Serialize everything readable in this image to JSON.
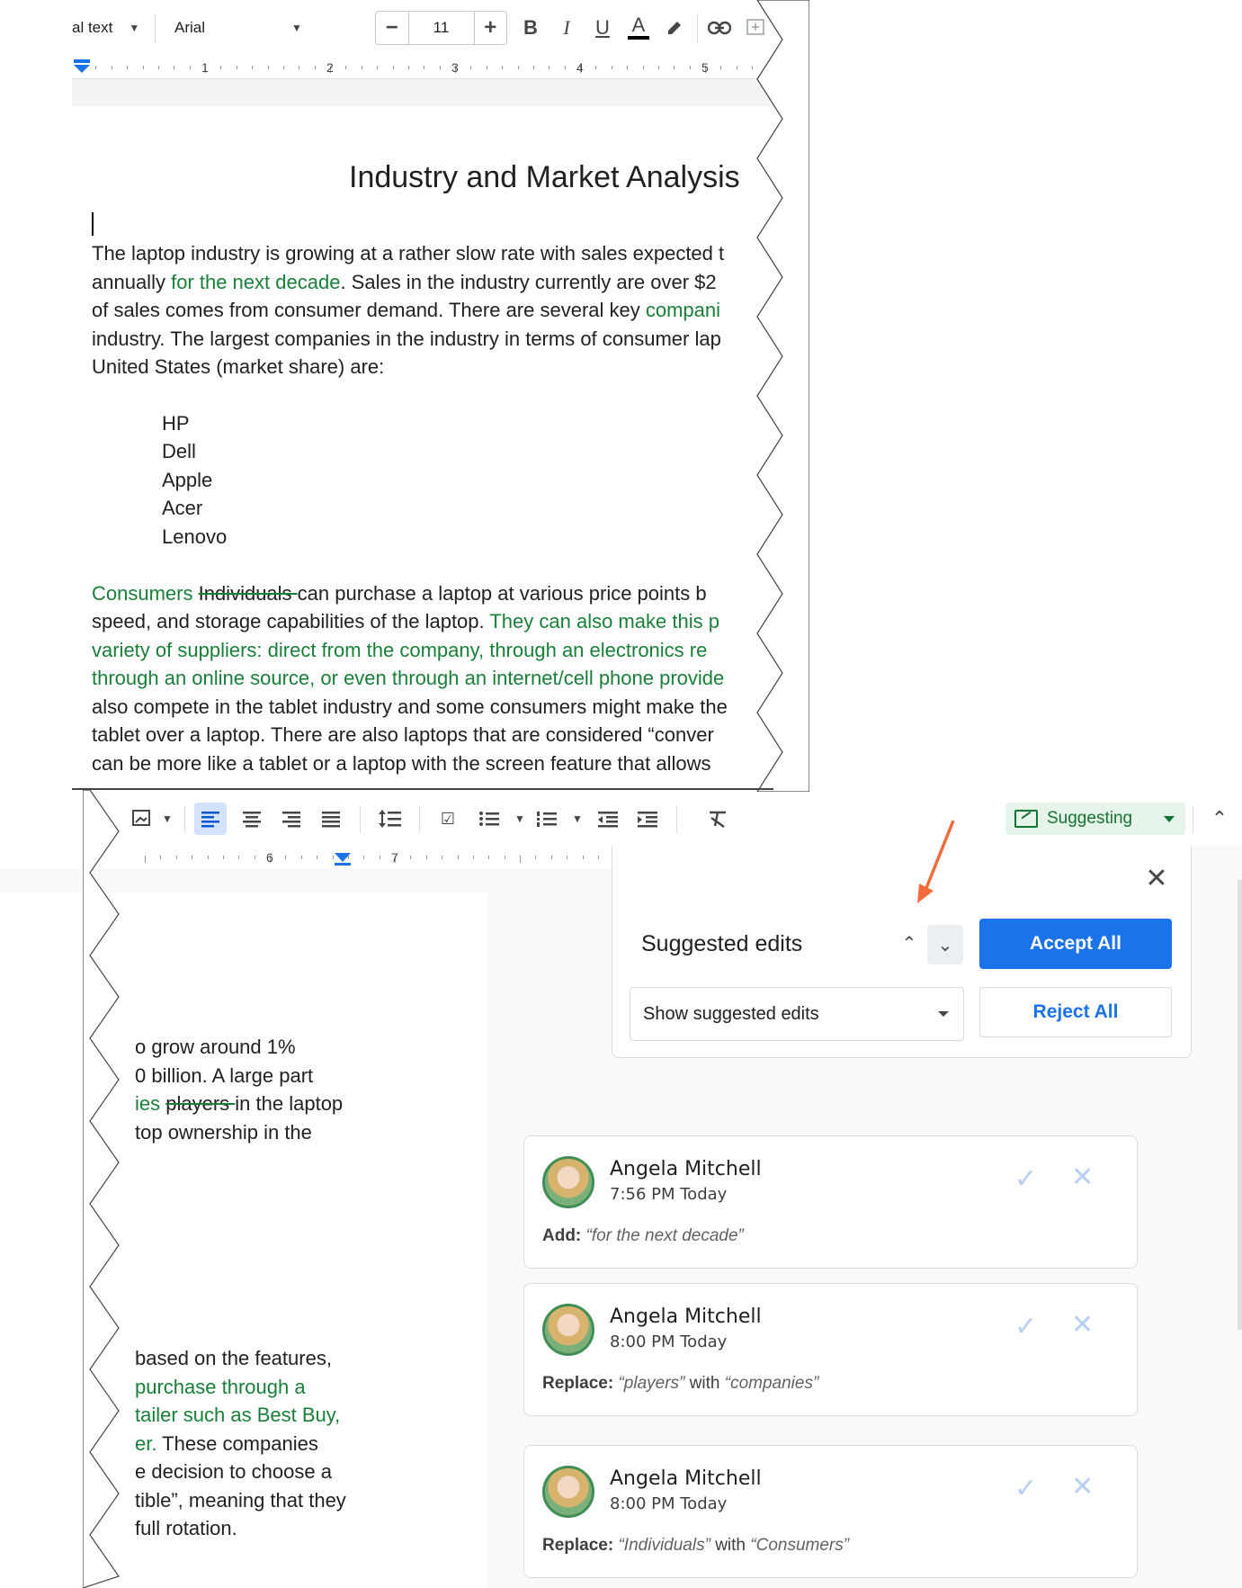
{
  "toolbar": {
    "style_label": "al text",
    "font_label": "Arial",
    "font_size": "11",
    "minus": "−",
    "plus": "+",
    "bold": "B",
    "italic": "I",
    "underline": "U",
    "text_color": "A"
  },
  "ruler_top": [
    "1",
    "2",
    "3",
    "4",
    "5"
  ],
  "ruler_bottom": [
    "6",
    "7"
  ],
  "document": {
    "title": "Industry and Market Analysis",
    "para1_lines": [
      [
        {
          "t": "The laptop industry is growing at a rather slow rate with sales expected t",
          "s": ""
        }
      ],
      [
        {
          "t": "annually ",
          "s": ""
        },
        {
          "t": "for the next decade",
          "s": "ins"
        },
        {
          "t": ".  Sales in the industry currently are over $2",
          "s": ""
        }
      ],
      [
        {
          "t": "of sales comes from consumer demand. There are several key ",
          "s": ""
        },
        {
          "t": "compani",
          "s": "ins"
        }
      ],
      [
        {
          "t": "industry.  The largest companies in the industry in terms of consumer lap",
          "s": ""
        }
      ],
      [
        {
          "t": "United States (market share) are:",
          "s": ""
        }
      ]
    ],
    "bullets": [
      "HP",
      "Dell",
      "Apple",
      "Acer",
      "Lenovo"
    ],
    "para2_lines": [
      [
        {
          "t": " Consumers ",
          "s": "ins"
        },
        {
          "t": "Individuals ",
          "s": "del"
        },
        {
          "t": "can purchase a laptop at various price points b",
          "s": ""
        }
      ],
      [
        {
          "t": "speed, and storage capabilities of the laptop. ",
          "s": ""
        },
        {
          "t": "They can also make this p",
          "s": "ins"
        }
      ],
      [
        {
          "t": "variety of suppliers: direct from the company, through an electronics re",
          "s": "ins"
        }
      ],
      [
        {
          "t": "through an online source, or even through an internet/cell phone provide",
          "s": "ins"
        }
      ],
      [
        {
          "t": "also compete in the tablet industry and some consumers might make the",
          "s": ""
        }
      ],
      [
        {
          "t": "tablet over a laptop.  There are also laptops that are considered “conver",
          "s": ""
        }
      ],
      [
        {
          "t": "can be more like a tablet or a laptop with the screen feature that allows",
          "s": ""
        }
      ]
    ],
    "right_lines_1": [
      [
        {
          "t": "o grow around 1%",
          "s": ""
        }
      ],
      [
        {
          "t": "0 billion.  A large part",
          "s": ""
        }
      ],
      [
        {
          "t": "ies ",
          "s": "ins"
        },
        {
          "t": "players ",
          "s": "del"
        },
        {
          "t": "in the laptop",
          "s": ""
        }
      ],
      [
        {
          "t": "top ownership in the",
          "s": ""
        }
      ]
    ],
    "right_lines_2": [
      [
        {
          "t": "based on the features,",
          "s": ""
        }
      ],
      [
        {
          "t": "purchase through a",
          "s": "ins"
        }
      ],
      [
        {
          "t": "tailer such as Best Buy,",
          "s": "ins"
        }
      ],
      [
        {
          "t": "er.",
          "s": "ins"
        },
        {
          "t": "  These companies",
          "s": ""
        }
      ],
      [
        {
          "t": "e decision to choose a",
          "s": ""
        }
      ],
      [
        {
          "t": "tible”, meaning that they",
          "s": ""
        }
      ],
      [
        {
          "t": " full rotation.",
          "s": ""
        }
      ]
    ]
  },
  "mode": {
    "label": "Suggesting"
  },
  "suggested_edits": {
    "title": "Suggested edits",
    "accept_all": "Accept All",
    "reject_all": "Reject All",
    "view_option": "Show suggested edits"
  },
  "suggestions": [
    {
      "author": "Angela Mitchell",
      "time": "7:56 PM Today",
      "action": "Add:",
      "parts": [
        {
          "t": "“for the next decade”",
          "i": true
        }
      ]
    },
    {
      "author": "Angela Mitchell",
      "time": "8:00 PM Today",
      "action": "Replace:",
      "parts": [
        {
          "t": "“players”",
          "i": true
        },
        {
          "t": " with ",
          "i": false
        },
        {
          "t": "“companies”",
          "i": true
        }
      ]
    },
    {
      "author": "Angela Mitchell",
      "time": "8:00 PM Today",
      "action": "Replace:",
      "parts": [
        {
          "t": "“Individuals”",
          "i": true
        },
        {
          "t": " with ",
          "i": false
        },
        {
          "t": "“Consumers”",
          "i": true
        }
      ]
    }
  ],
  "colors": {
    "accent": "#1a73e8",
    "suggest_green": "#188038",
    "annotation_arrow": "#f26b3a"
  }
}
